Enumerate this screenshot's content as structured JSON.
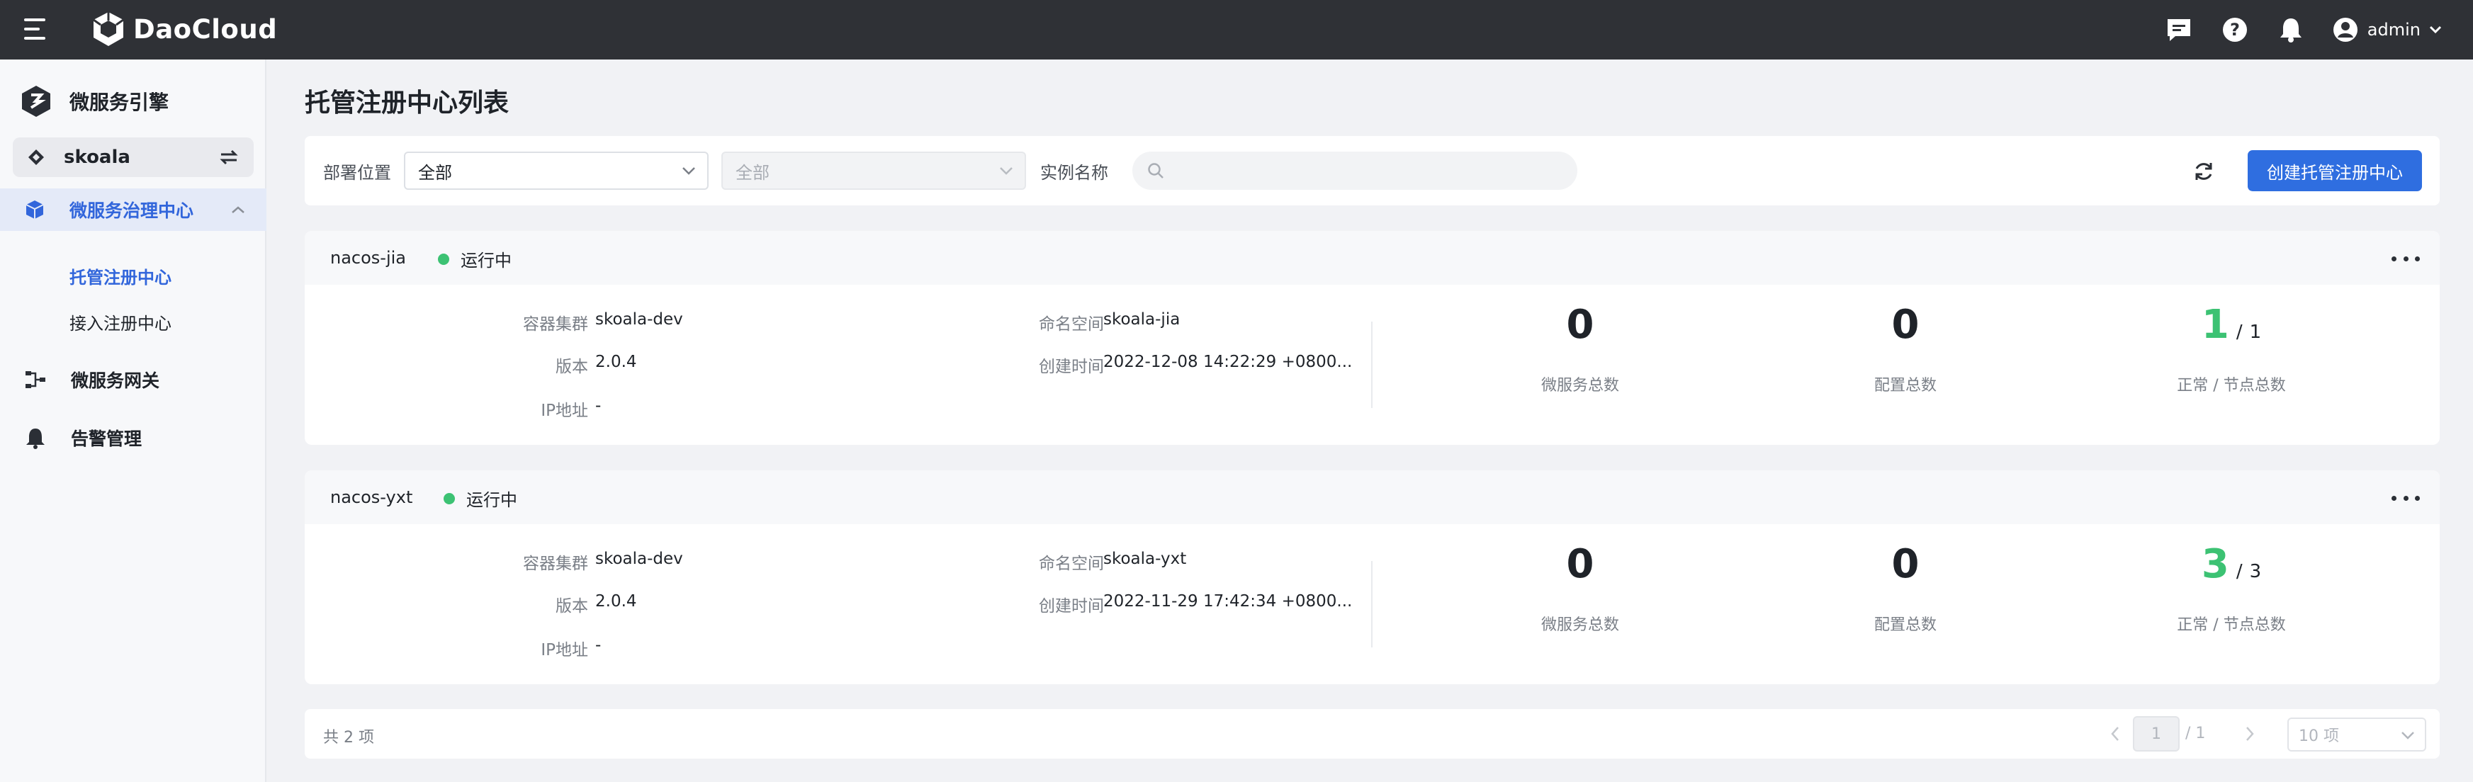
{
  "app": {
    "brand": "DaoCloud",
    "user": "admin"
  },
  "sidebar": {
    "module_title": "微服务引擎",
    "workspace": "skoala",
    "group": {
      "label": "微服务治理中心"
    },
    "sub_items": [
      {
        "label": "托管注册中心",
        "active": true
      },
      {
        "label": "接入注册中心",
        "active": false
      }
    ],
    "items": [
      {
        "label": "微服务网关",
        "icon": "gateway-icon"
      },
      {
        "label": "告警管理",
        "icon": "bell-icon"
      }
    ]
  },
  "page": {
    "title": "托管注册中心列表"
  },
  "filters": {
    "location_label": "部署位置",
    "location_value": "全部",
    "cluster_value": "全部",
    "instance_label": "实例名称",
    "instance_placeholder": "",
    "create_label": "创建托管注册中心"
  },
  "labels": {
    "cluster": "容器集群",
    "version": "版本",
    "ip": "IP地址",
    "namespace": "命名空间",
    "created": "创建时间",
    "services_total": "微服务总数",
    "configs_total": "配置总数",
    "nodes_ratio": "正常 / 节点总数"
  },
  "instances": [
    {
      "name": "nacos-jia",
      "status": "运行中",
      "cluster": "skoala-dev",
      "version": "2.0.4",
      "ip": "-",
      "namespace": "skoala-jia",
      "created": "2022-12-08 14:22:29 +0800...",
      "services": "0",
      "configs": "0",
      "nodes_ok": "1",
      "nodes_total": "1"
    },
    {
      "name": "nacos-yxt",
      "status": "运行中",
      "cluster": "skoala-dev",
      "version": "2.0.4",
      "ip": "-",
      "namespace": "skoala-yxt",
      "created": "2022-11-29 17:42:34 +0800...",
      "services": "0",
      "configs": "0",
      "nodes_ok": "3",
      "nodes_total": "3"
    }
  ],
  "pagination": {
    "total": "共 2 项",
    "current": "1",
    "of": "/ 1",
    "page_size": "10 项"
  },
  "colors": {
    "primary": "#2f6ee0",
    "running": "#3cc273",
    "topbar": "#2f3136"
  }
}
